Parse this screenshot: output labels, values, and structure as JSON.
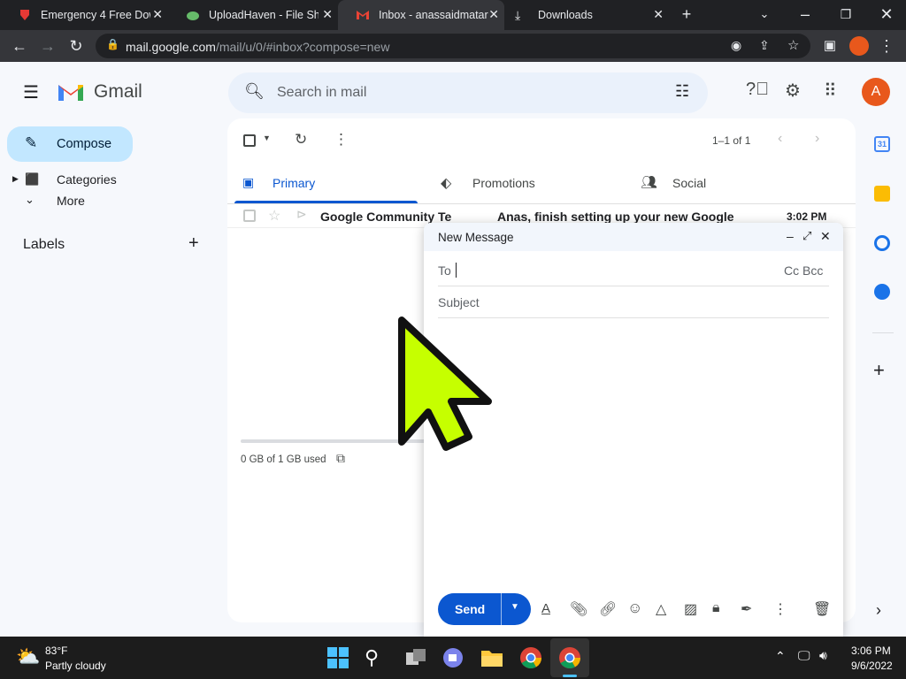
{
  "browser": {
    "tabs": [
      {
        "title": "Emergency 4 Free Dow",
        "icon": "red-download-icon"
      },
      {
        "title": "UploadHaven - File Sha",
        "icon": "cloud-icon"
      },
      {
        "title": "Inbox - anassaidmatari",
        "icon": "gmail-icon"
      },
      {
        "title": "Downloads",
        "icon": "download-icon"
      }
    ],
    "url_host": "mail.google.com",
    "url_path": "/mail/u/0/#inbox?compose=new"
  },
  "gmail": {
    "brand": "Gmail",
    "compose_label": "Compose",
    "nav": {
      "categories": "Categories",
      "more": "More"
    },
    "labels_heading": "Labels",
    "search_placeholder": "Search in mail",
    "avatar_letter": "A",
    "pagination": "1–1 of 1",
    "tabs": {
      "primary": "Primary",
      "promotions": "Promotions",
      "social": "Social"
    },
    "email": {
      "sender": "Google Community Te",
      "subject": "Anas, finish setting up your new Google",
      "time": "3:02 PM"
    },
    "storage": "0 GB of 1 GB used"
  },
  "compose_window": {
    "title": "New Message",
    "to_label": "To",
    "cc_bcc": "Cc Bcc",
    "subject_placeholder": "Subject",
    "send_label": "Send"
  },
  "taskbar": {
    "weather_temp": "83°F",
    "weather_desc": "Partly cloudy",
    "time": "3:06 PM",
    "date": "9/6/2022"
  },
  "colors": {
    "accent": "#0b57d0",
    "compose_bg": "#c2e7ff",
    "cursor": "#c6ff00",
    "avatar": "#e8581c"
  }
}
